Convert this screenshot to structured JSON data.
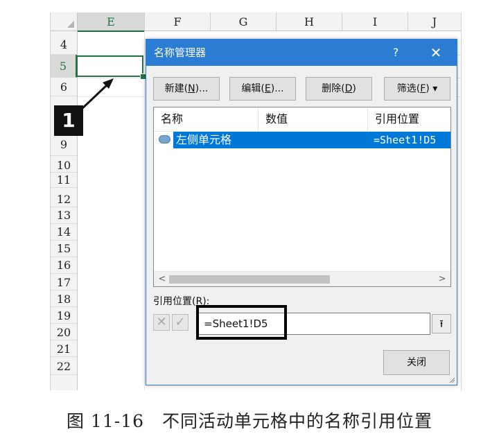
{
  "sheet": {
    "columns": [
      "E",
      "F",
      "G",
      "H",
      "I",
      "J"
    ],
    "selected_column": "E",
    "rows": [
      "4",
      "5",
      "6",
      "9",
      "10",
      "11",
      "12",
      "13",
      "14",
      "15",
      "16",
      "17",
      "18",
      "19",
      "20",
      "21",
      "22"
    ],
    "selected_row": "5"
  },
  "annotation": {
    "badge": "1"
  },
  "dialog": {
    "title": "名称管理器",
    "help": "?",
    "close": "✕",
    "buttons": {
      "new_label": "新建(",
      "new_key": "N",
      "new_suffix": ")...",
      "edit_label": "编辑(",
      "edit_key": "E",
      "edit_suffix": ")...",
      "delete_label": "删除(",
      "delete_key": "D",
      "delete_suffix": ")",
      "filter_label": "筛选(",
      "filter_key": "F",
      "filter_suffix": ") ▾"
    },
    "list": {
      "headers": [
        "名称",
        "数值",
        "引用位置"
      ],
      "rows": [
        {
          "name": "左侧单元格",
          "value": "",
          "ref": "=Sheet1!D5"
        }
      ]
    },
    "ref_label": "引用位置(",
    "ref_key": "R",
    "ref_suffix": "):",
    "ref_value": "=Sheet1!D5",
    "cancel_icon": "✕",
    "confirm_icon": "✓",
    "upload_icon": "⭱",
    "close_button": "关闭"
  },
  "caption": "图 11-16　不同活动单元格中的名称引用位置",
  "colors": {
    "accent": "#2b7cd3",
    "selection": "#0078d7",
    "excel_green": "#217346"
  }
}
